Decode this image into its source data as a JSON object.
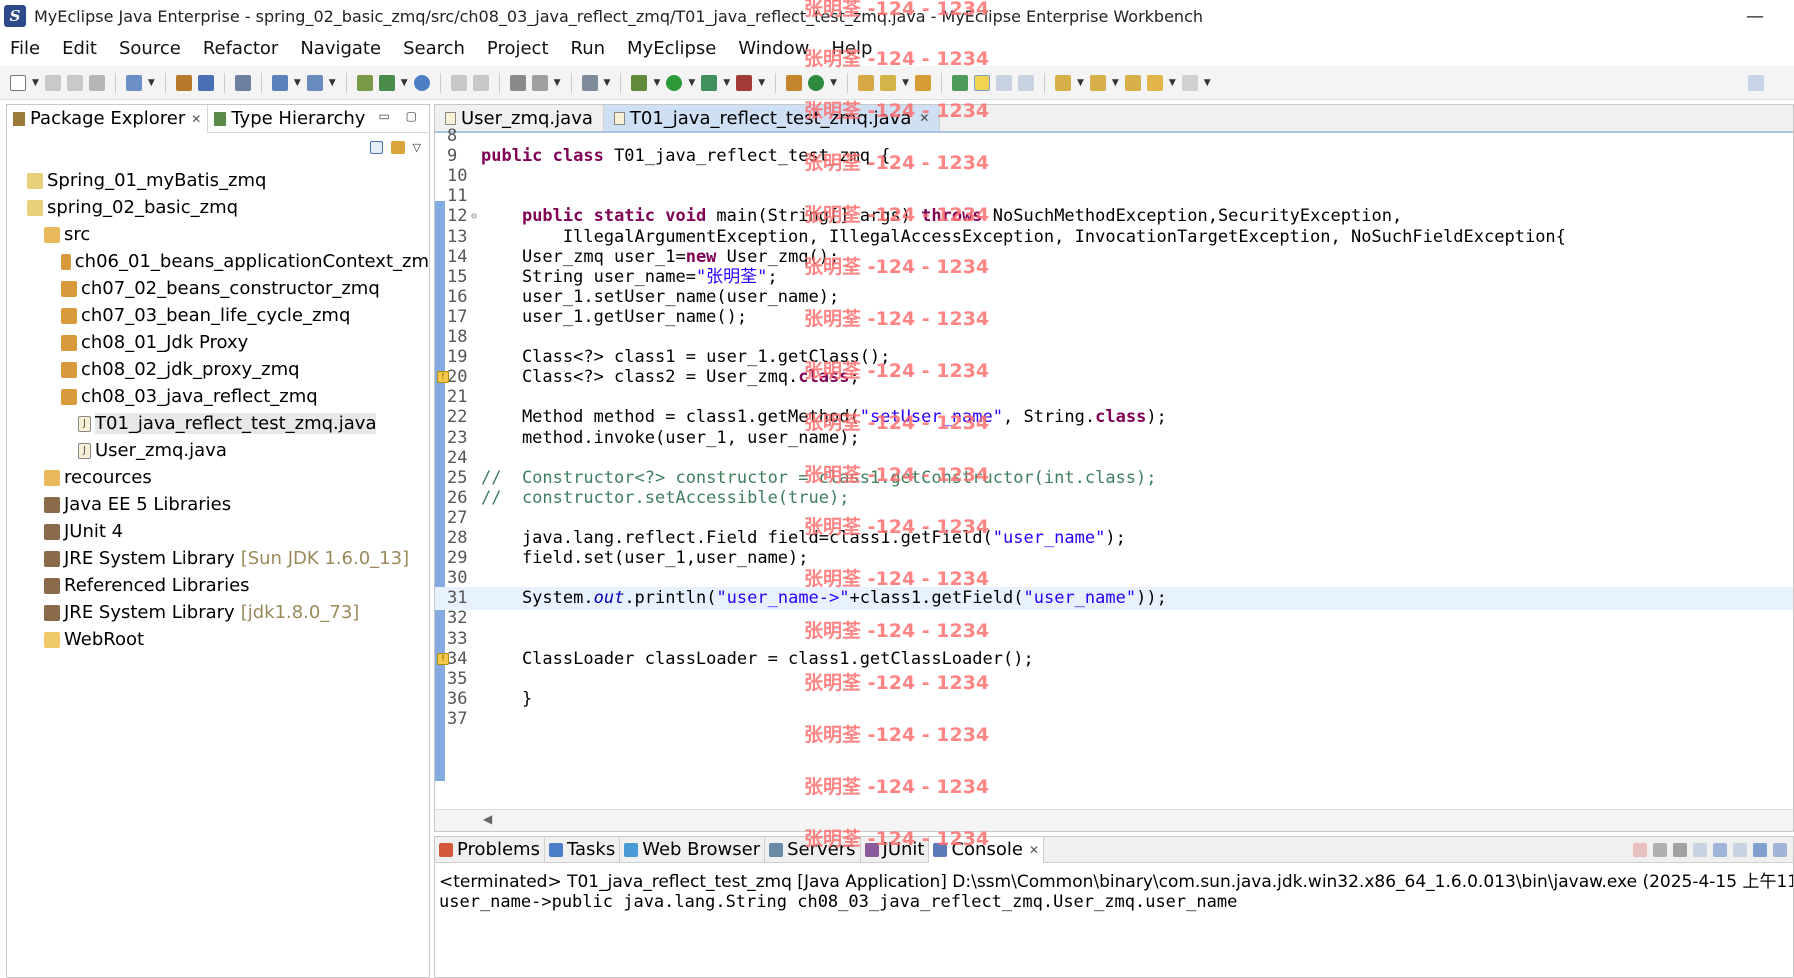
{
  "window": {
    "title": "MyEclipse Java Enterprise - spring_02_basic_zmq/src/ch08_03_java_reflect_zmq/T01_java_reflect_test_zmq.java - MyEclipse Enterprise Workbench",
    "app_icon_label": "S"
  },
  "menu": [
    "File",
    "Edit",
    "Source",
    "Refactor",
    "Navigate",
    "Search",
    "Project",
    "Run",
    "MyEclipse",
    "Window",
    "Help"
  ],
  "left_panel": {
    "tabs": [
      {
        "label": "Package Explorer",
        "active": true
      },
      {
        "label": "Type Hierarchy",
        "active": false
      }
    ],
    "tree": [
      {
        "label": "Spring_01_myBatis_zmq",
        "indent": 0,
        "icon": "project-icon"
      },
      {
        "label": "spring_02_basic_zmq",
        "indent": 0,
        "icon": "project-icon"
      },
      {
        "label": "src",
        "indent": 1,
        "icon": "source-folder-icon"
      },
      {
        "label": "ch06_01_beans_applicationContext_zm",
        "indent": 2,
        "icon": "package-icon"
      },
      {
        "label": "ch07_02_beans_constructor_zmq",
        "indent": 2,
        "icon": "package-icon"
      },
      {
        "label": "ch07_03_bean_life_cycle_zmq",
        "indent": 2,
        "icon": "package-icon"
      },
      {
        "label": "ch08_01_Jdk Proxy",
        "indent": 2,
        "icon": "package-icon"
      },
      {
        "label": "ch08_02_jdk_proxy_zmq",
        "indent": 2,
        "icon": "package-icon"
      },
      {
        "label": "ch08_03_java_reflect_zmq",
        "indent": 2,
        "icon": "package-icon"
      },
      {
        "label": "T01_java_reflect_test_zmq.java",
        "indent": 3,
        "icon": "java-file-icon",
        "selected": true
      },
      {
        "label": "User_zmq.java",
        "indent": 3,
        "icon": "java-file-icon"
      },
      {
        "label": "recources",
        "indent": 1,
        "icon": "source-folder-icon"
      },
      {
        "label": "Java EE 5 Libraries",
        "indent": 1,
        "icon": "library-icon"
      },
      {
        "label": "JUnit 4",
        "indent": 1,
        "icon": "library-icon"
      },
      {
        "label": "JRE System Library",
        "sub": "[Sun JDK 1.6.0_13]",
        "indent": 1,
        "icon": "library-icon"
      },
      {
        "label": "Referenced Libraries",
        "indent": 1,
        "icon": "library-icon"
      },
      {
        "label": "JRE System Library",
        "sub": "[jdk1.8.0_73]",
        "indent": 1,
        "icon": "library-icon"
      },
      {
        "label": "WebRoot",
        "indent": 1,
        "icon": "folder-icon"
      }
    ]
  },
  "editor": {
    "tabs": [
      {
        "label": "User_zmq.java",
        "active": false
      },
      {
        "label": "T01_java_reflect_test_zmq.java",
        "active": true
      }
    ],
    "lines": [
      {
        "n": "8",
        "html": ""
      },
      {
        "n": "9",
        "html": "<span class=\"kw\">public class</span> T01_java_reflect_test_zmq {"
      },
      {
        "n": "10",
        "html": ""
      },
      {
        "n": "11",
        "html": ""
      },
      {
        "n": "12",
        "html": "    <span class=\"kw\">public static void</span> main(String[] args) <span class=\"kw\">throws</span> NoSuchMethodException,SecurityException,",
        "fold": true
      },
      {
        "n": "13",
        "html": "        IllegalArgumentException, IllegalAccessException, InvocationTargetException, NoSuchFieldException{"
      },
      {
        "n": "14",
        "html": "    User_zmq user_1=<span class=\"kw\">new</span> User_zmq();"
      },
      {
        "n": "15",
        "html": "    String user_name=<span class=\"str\">\"张明荃\"</span>;"
      },
      {
        "n": "16",
        "html": "    user_1.setUser_name(user_name);"
      },
      {
        "n": "17",
        "html": "    user_1.getUser_name();"
      },
      {
        "n": "18",
        "html": ""
      },
      {
        "n": "19",
        "html": "    Class&lt;?&gt; class1 = user_1.getClass();"
      },
      {
        "n": "20",
        "html": "    Class&lt;?&gt; class2 = User_zmq.<span class=\"kw\">class</span>;",
        "warn": true
      },
      {
        "n": "21",
        "html": ""
      },
      {
        "n": "22",
        "html": "    Method method = class1.getMethod(<span class=\"str\">\"setUser_name\"</span>, String.<span class=\"kw\">class</span>);"
      },
      {
        "n": "23",
        "html": "    method.invoke(user_1, user_name);"
      },
      {
        "n": "24",
        "html": ""
      },
      {
        "n": "25",
        "html": "<span class=\"cm\">//  Constructor&lt;?&gt; constructor = class1.getConstructor(int.class);</span>"
      },
      {
        "n": "26",
        "html": "<span class=\"cm\">//  constructor.setAccessible(true);</span>"
      },
      {
        "n": "27",
        "html": ""
      },
      {
        "n": "28",
        "html": "    java.lang.reflect.Field field=class1.getField(<span class=\"str\">\"user_name\"</span>);"
      },
      {
        "n": "29",
        "html": "    field.set(user_1,user_name);"
      },
      {
        "n": "30",
        "html": ""
      },
      {
        "n": "31",
        "html": "    System.<span class=\"it\">out</span>.println(<span class=\"str\">\"user_name-&gt;\"</span>+class1.getField(<span class=\"str\">\"user_name\"</span>));",
        "current": true
      },
      {
        "n": "32",
        "html": ""
      },
      {
        "n": "33",
        "html": ""
      },
      {
        "n": "34",
        "html": "    ClassLoader classLoader = class1.getClassLoader();",
        "warn": true
      },
      {
        "n": "35",
        "html": ""
      },
      {
        "n": "36",
        "html": "    }"
      },
      {
        "n": "37",
        "html": ""
      }
    ]
  },
  "bottom_panel": {
    "tabs": [
      {
        "label": "Problems",
        "active": false
      },
      {
        "label": "Tasks",
        "active": false
      },
      {
        "label": "Web Browser",
        "active": false
      },
      {
        "label": "Servers",
        "active": false
      },
      {
        "label": "JUnit",
        "active": false
      },
      {
        "label": "Console",
        "active": true
      }
    ],
    "console_status": "<terminated> T01_java_reflect_test_zmq [Java Application] D:\\ssm\\Common\\binary\\com.sun.java.jdk.win32.x86_64_1.6.0.013\\bin\\javaw.exe (2025-4-15 上午11",
    "console_output": "user_name->public java.lang.String ch08_03_java_reflect_zmq.User_zmq.user_name"
  },
  "watermark": {
    "text": "张明荃 -124 - 1234",
    "color": "#ff6f6f"
  }
}
